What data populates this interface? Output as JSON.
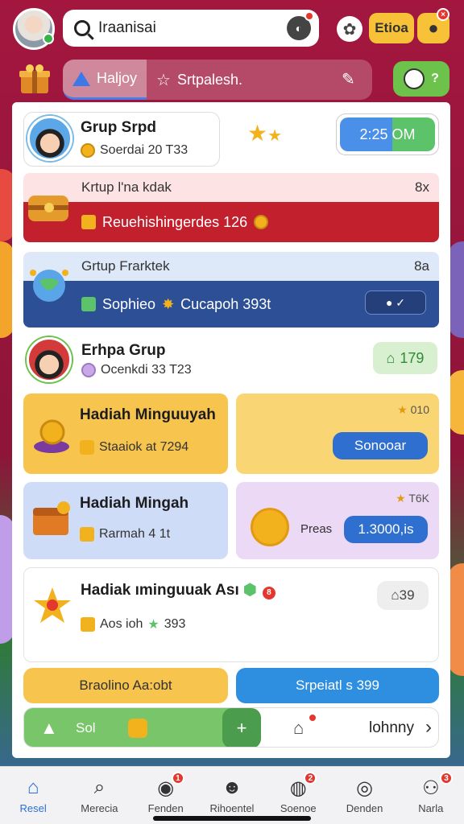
{
  "colors": {
    "accent": "#2c6fd6",
    "brand": "#a3173f",
    "red": "#c3202e",
    "navy": "#2d4f95",
    "green": "#79c66a",
    "yellow": "#f7c238"
  },
  "topbar": {
    "search_value": "Iraanisai",
    "search_icon": "search-icon",
    "mic_icon": "mic-icon",
    "mic_badge": "",
    "gear_icon": "gear-icon",
    "yellow_button_label": "Etioa",
    "cookie_badge": "×"
  },
  "subbar": {
    "tabs": [
      {
        "label": "Haljoy",
        "icon": "triangle-icon"
      },
      {
        "label": "Srtpalesh.",
        "icon": "star-icon"
      }
    ],
    "ghost_button_label": "?"
  },
  "groups": [
    {
      "title": "Grup Srpd",
      "sub": "Soerdai 20 T33",
      "time": "2:25 OM"
    },
    {
      "title": "Krtup l'na kdak",
      "corner": "8x",
      "banner": "Reuehishingerdes 126"
    },
    {
      "title": "Grtup Frarktek",
      "corner": "8a",
      "banner": "Sophieo",
      "banner2": "Cucapoh 393t"
    },
    {
      "title": "Erhpa Grup",
      "sub": "Ocenkdi 33 T23",
      "pill": "179"
    }
  ],
  "cards": [
    {
      "title": "Hadiah Minguuyah",
      "sub": "Staaiok at 7294",
      "corner": "010",
      "button": "Sonooar"
    },
    {
      "title": "Hadiah Mingah",
      "sub": "Rarmah 4 1t",
      "corner": "T6K",
      "coin_label": "Preas",
      "button": "1.3000,is"
    },
    {
      "title": "Hadiak ıminguuak Ası",
      "badge": "8",
      "sub": "Aos ioh",
      "sub2": "393",
      "pill": "39"
    }
  ],
  "actions": {
    "left_button": "Braolino Aa:obt",
    "right_button": "Srpeiatl s 399"
  },
  "bottomrow": {
    "so_label": "Sol",
    "plus": "+",
    "right_label": "lohnny",
    "chevron": "›"
  },
  "tabbar": [
    {
      "label": "Resel",
      "icon": "home-icon",
      "active": true
    },
    {
      "label": "Merecia",
      "icon": "search-icon"
    },
    {
      "label": "Fenden",
      "icon": "group-icon",
      "badge": "1"
    },
    {
      "label": "Rihoentel",
      "icon": "smile-icon"
    },
    {
      "label": "Soenoe",
      "icon": "chat-icon",
      "badge": "2"
    },
    {
      "label": "Denden",
      "icon": "user-icon"
    },
    {
      "label": "Narla",
      "icon": "profile-icon",
      "badge": "3"
    }
  ]
}
